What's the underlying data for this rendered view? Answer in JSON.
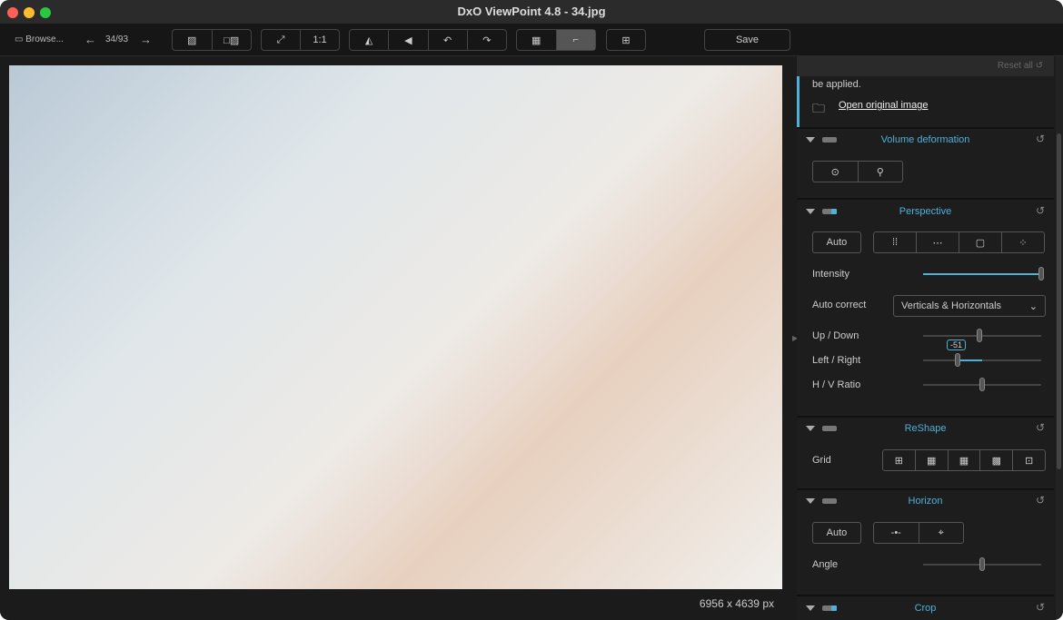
{
  "window": {
    "title": "DxO ViewPoint 4.8 - 34.jpg"
  },
  "toolbar": {
    "browse": "Browse...",
    "counter": "34/93",
    "zoom_1_1": "1:1",
    "save": "Save"
  },
  "viewer": {
    "image_description_icon": "photo",
    "dimensions": "6956 x 4639 px"
  },
  "panel": {
    "reset_all": "Reset all",
    "notice_text": "be applied.",
    "open_original": "Open original image",
    "volume": {
      "title": "Volume deformation",
      "enabled": false
    },
    "perspective": {
      "title": "Perspective",
      "enabled": true,
      "auto": "Auto",
      "intensity_label": "Intensity",
      "intensity": 100,
      "autocorrect_label": "Auto correct",
      "autocorrect_value": "Verticals & Horizontals",
      "updown_label": "Up / Down",
      "updown": 0,
      "leftright_label": "Left / Right",
      "leftright": "-51",
      "hv_label": "H / V Ratio",
      "hv": 0
    },
    "reshape": {
      "title": "ReShape",
      "enabled": false,
      "grid_label": "Grid"
    },
    "horizon": {
      "title": "Horizon",
      "enabled": false,
      "auto": "Auto",
      "angle_label": "Angle",
      "angle": 0
    },
    "crop": {
      "title": "Crop",
      "enabled": true
    }
  },
  "colors": {
    "accent": "#4fb0d9"
  }
}
